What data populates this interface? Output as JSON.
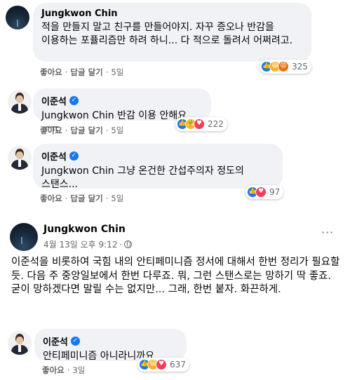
{
  "comments": [
    {
      "author": "Jungkwon Chin",
      "verified": false,
      "text": "적을 만들지 말고 친구를 만들어야지. 자꾸 증오나 반감을 이용하는 포퓰리즘만 하려 하니... 다 적으로 돌려서 어쩌려고.",
      "like_label": "좋아요",
      "reply_label": "답글 달기",
      "time": "5일",
      "reaction_icons": [
        "like-icon",
        "haha-icon",
        "angry-icon"
      ],
      "reaction_count": "325"
    },
    {
      "author": "이준석",
      "verified": true,
      "text": "Jungkwon Chin 반감 이용 안해요 ㅜㅠ",
      "like_label": "좋아요",
      "reply_label": "답글 달기",
      "time": "5일",
      "reaction_icons": [
        "like-icon",
        "care-icon",
        "love-icon"
      ],
      "reaction_count": "222"
    },
    {
      "author": "이준석",
      "verified": true,
      "text": "Jungkwon Chin 그냥 온건한 간섭주의자 정도의 스탠스...",
      "like_label": "좋아요",
      "reply_label": "답글 달기",
      "time": "5일",
      "reaction_icons": [
        "like-icon",
        "love-icon"
      ],
      "reaction_count": "97"
    }
  ],
  "post": {
    "author": "Jungkwon Chin",
    "date": "4월 13일 오후 9:12",
    "more_label": "···",
    "body": "이준석을 비롯하여 국힘 내의 안티페미니즘  정서에 대해서 한번 정리가 필요할 듯. 다음 주 중앙일보에서 한번 다루죠. 뭐, 그런 스탠스로는 망하기  딱 좋죠. 굳이 망하겠다면 말릴 수는 없지만... 그래, 한번 붙자. 화끈하게."
  },
  "reply": {
    "author": "이준석",
    "verified": true,
    "text": "안티페미니즘 아니라니까요...",
    "like_label": "좋아요",
    "time": "3일",
    "reaction_icons": [
      "like-icon",
      "haha-icon",
      "love-icon"
    ],
    "reaction_count": "637"
  }
}
